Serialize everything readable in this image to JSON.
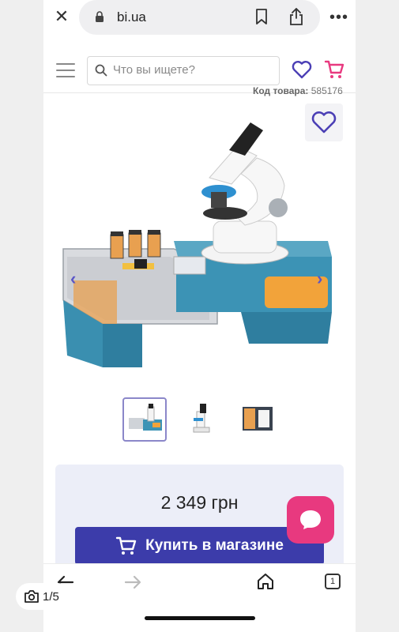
{
  "browser": {
    "url": "bi.ua",
    "more_label": "•••"
  },
  "header": {
    "search_placeholder": "Что вы ищете?"
  },
  "product": {
    "sku_label": "Код товара:",
    "sku_value": "585176",
    "price": "2 349 грн",
    "buy_label": "Купить в магазине",
    "thumbnails": [
      "microscope-set-thumb",
      "microscope-thumb",
      "box-thumb"
    ]
  },
  "toolbar": {
    "tabs_count": "1"
  },
  "photo_counter": "1/5",
  "colors": {
    "accent": "#3c3caa",
    "heart": "#4b3fb5",
    "cart": "#e8397f",
    "chat": "#e8397f",
    "price_bg": "#eceef8"
  }
}
